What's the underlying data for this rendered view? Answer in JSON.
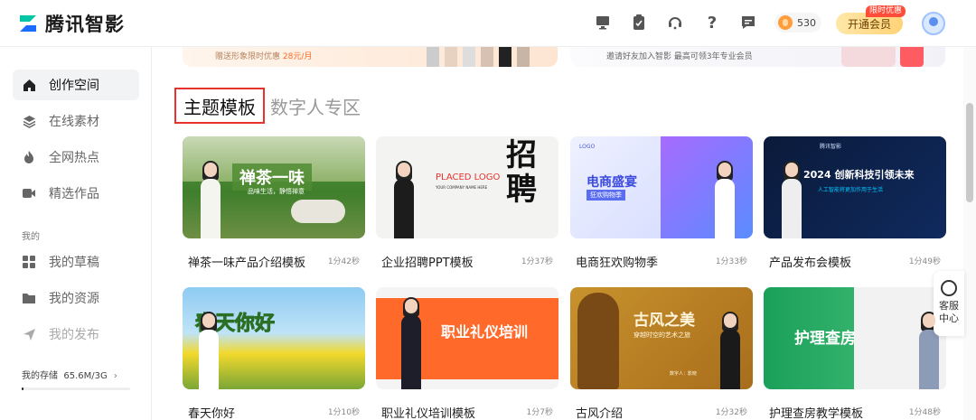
{
  "app": {
    "name": "腾讯智影"
  },
  "header": {
    "icons": [
      "monitor-icon",
      "clipboard-icon",
      "headset-icon",
      "help-icon",
      "message-icon"
    ],
    "coins": "530",
    "vip_button": "开通会员",
    "vip_badge": "限时优惠"
  },
  "sidebar": {
    "items": [
      {
        "label": "创作空间",
        "icon": "home-icon",
        "active": true
      },
      {
        "label": "在线素材",
        "icon": "layers-icon"
      },
      {
        "label": "全网热点",
        "icon": "flame-icon"
      },
      {
        "label": "精选作品",
        "icon": "video-icon"
      }
    ],
    "section_label": "我的",
    "my_items": [
      {
        "label": "我的草稿",
        "icon": "grid-icon"
      },
      {
        "label": "我的资源",
        "icon": "folder-icon"
      },
      {
        "label": "我的发布",
        "icon": "send-icon"
      }
    ],
    "storage": {
      "label": "我的存储",
      "value": "65.6M/3G",
      "fraction": 0.02
    }
  },
  "banners": [
    {
      "text": "赠送形象限时优惠 ",
      "price": "28元/月"
    },
    {
      "text": "邀请好友加入智影 最高可领3年专业会员"
    }
  ],
  "tabs": {
    "active": "主题模板",
    "other": "数字人专区"
  },
  "cards": [
    {
      "title": "禅茶一味产品介绍模板",
      "duration": "1分42秒",
      "thumb_title": "禅茶一味",
      "thumb_sub": "品味生活，静悟禅意"
    },
    {
      "title": "企业招聘PPT模板",
      "duration": "1分37秒",
      "thumb_title": "招聘",
      "thumb_sub": "PLACED LOGO",
      "thumb_sub2": "YOUR COMPANY NAME HERE"
    },
    {
      "title": "电商狂欢购物季",
      "duration": "1分33秒",
      "thumb_title": "电商盛宴",
      "thumb_sub": "狂欢购物季",
      "thumb_sub2": "LOGO"
    },
    {
      "title": "产品发布会模板",
      "duration": "1分49秒",
      "thumb_title": "2024 创新科技引领未来",
      "thumb_sub": "人工智能将更加作用于生活",
      "thumb_sub2": "腾讯智影"
    },
    {
      "title": "春天你好",
      "duration": "1分10秒",
      "thumb_title": "春天你好"
    },
    {
      "title": "职业礼仪培训模板",
      "duration": "1分7秒",
      "thumb_title": "职业礼仪培训"
    },
    {
      "title": "古风介绍",
      "duration": "1分32秒",
      "thumb_title": "古风之美",
      "thumb_sub": "穿越时空的艺术之旅",
      "thumb_sub2": "数字人：影晓"
    },
    {
      "title": "护理查房教学模板",
      "duration": "1分48秒",
      "thumb_title": "护理查房"
    }
  ],
  "customer_service": {
    "label": "客服中心"
  },
  "colors": {
    "accent": "#e8322d",
    "vip": "#ffd277"
  }
}
